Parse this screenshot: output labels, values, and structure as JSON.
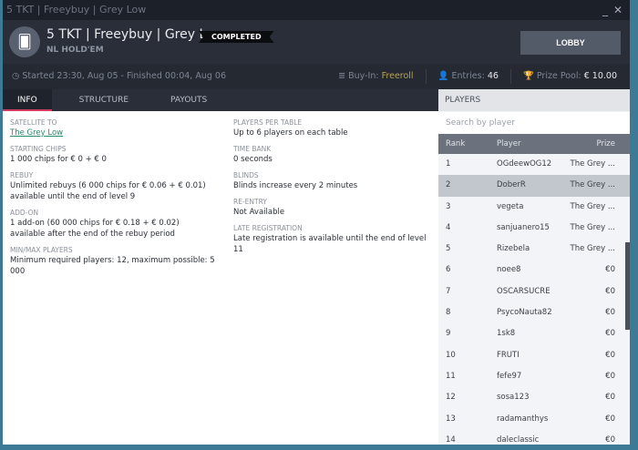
{
  "window": {
    "title": "5 TKT | Freeybuy | Grey Low",
    "minimize": "_",
    "close": "✕"
  },
  "header": {
    "title": "5 TKT | Freeybuy | Grey Low",
    "status": "COMPLETED",
    "game": "NL HOLD'EM",
    "lobby": "LOBBY",
    "icon": "cards-icon"
  },
  "infobar": {
    "times": "Started 23:30, Aug 05  -  Finished 00:04, Aug 06",
    "buyin_label": "Buy-In:",
    "buyin": "Freeroll",
    "entries_label": "Entries:",
    "entries": "46",
    "prize_label": "Prize Pool:",
    "prize": "€ 10.00"
  },
  "tabs": [
    "INFO",
    "STRUCTURE",
    "PAYOUTS"
  ],
  "info_left": [
    {
      "label": "SATELLITE TO",
      "value": "The Grey Low",
      "link": true
    },
    {
      "label": "STARTING CHIPS",
      "value": "1 000 chips for € 0 + € 0"
    },
    {
      "label": "REBUY",
      "value": "Unlimited rebuys (6 000 chips for € 0.06 + € 0.01) available until the end of level 9"
    },
    {
      "label": "ADD-ON",
      "value": "1 add-on (60 000 chips for € 0.18 + € 0.02) available after the end of the rebuy period"
    },
    {
      "label": "MIN/MAX PLAYERS",
      "value": "Minimum required players: 12, maximum possible: 5 000"
    }
  ],
  "info_right": [
    {
      "label": "PLAYERS PER TABLE",
      "value": "Up to 6 players on each table"
    },
    {
      "label": "TIME BANK",
      "value": "0 seconds"
    },
    {
      "label": "BLINDS",
      "value": "Blinds increase every 2 minutes"
    },
    {
      "label": "RE-ENTRY",
      "value": "Not Available"
    },
    {
      "label": "LATE REGISTRATION",
      "value": "Late registration is available until the end of level 11"
    }
  ],
  "players": {
    "title": "PLAYERS",
    "search_placeholder": "Search by player",
    "columns": [
      "Rank",
      "Player",
      "Prize"
    ],
    "rows": [
      [
        "1",
        "OGdeewOG12",
        "The Grey ..."
      ],
      [
        "2",
        "DoberR",
        "The Grey ..."
      ],
      [
        "3",
        "vegeta",
        "The Grey ..."
      ],
      [
        "4",
        "sanjuanero15",
        "The Grey ..."
      ],
      [
        "5",
        "Rizebela",
        "The Grey ..."
      ],
      [
        "6",
        "noee8",
        "€0"
      ],
      [
        "7",
        "OSCARSUCRE",
        "€0"
      ],
      [
        "8",
        "PsycoNauta82",
        "€0"
      ],
      [
        "9",
        "1sk8",
        "€0"
      ],
      [
        "10",
        "FRUTI",
        "€0"
      ],
      [
        "11",
        "fefe97",
        "€0"
      ],
      [
        "12",
        "sosa123",
        "€0"
      ],
      [
        "13",
        "radamanthys",
        "€0"
      ],
      [
        "14",
        "daleclassic",
        "€0"
      ]
    ],
    "selected": 1
  }
}
